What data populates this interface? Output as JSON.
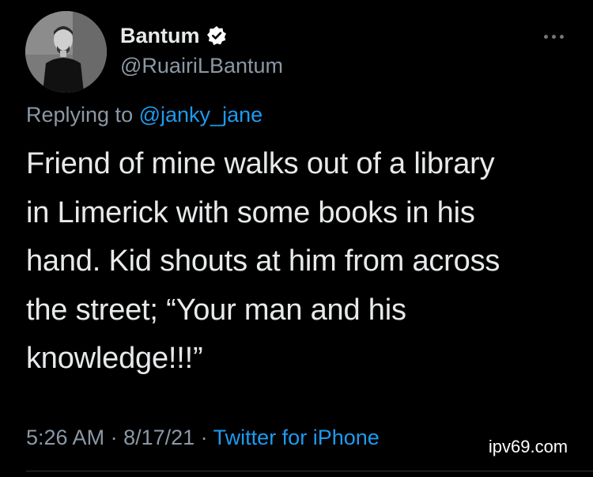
{
  "tweet": {
    "author": {
      "display_name": "Bantum",
      "handle": "@RuairiLBantum",
      "verified": true
    },
    "reply": {
      "prefix": "Replying to",
      "mention": "@janky_jane"
    },
    "text_lines": [
      "Friend of mine walks out of a library",
      "in Limerick with some books in his",
      "hand. Kid shouts at him from across",
      "the street; “Your man and his",
      "knowledge!!!”"
    ],
    "time": "5:26 AM",
    "separator": " · ",
    "date": "8/17/21",
    "source": "Twitter for iPhone"
  },
  "watermark": "ipv69.com",
  "icons": {
    "verified": "verified-badge-icon",
    "more": "more-horizontal-icon"
  },
  "colors": {
    "background": "#000000",
    "primary_text": "#e7e9ea",
    "secondary_text": "#8b98a5",
    "accent": "#1d9bf0"
  }
}
